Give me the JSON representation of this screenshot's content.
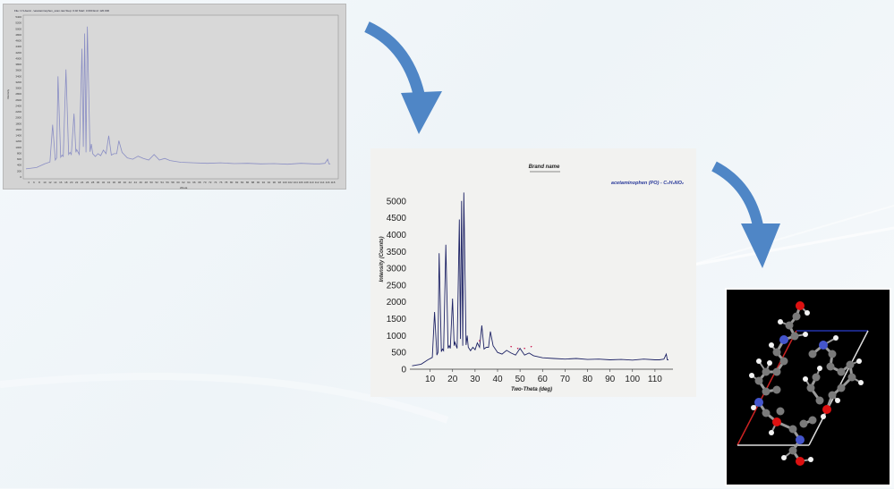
{
  "raw_plot": {
    "header_text": "File: C:\\Users\\...\\acetaminophen_scan.raw  Step: 0.02  Start: 3.000  End: 120.000",
    "ylabel": "Intensity",
    "xlabel": "2theta",
    "yticks": [
      "0",
      "200",
      "400",
      "600",
      "800",
      "1000",
      "1200",
      "1400",
      "1600",
      "1800",
      "2000",
      "2200",
      "2400",
      "2600",
      "2800",
      "3000",
      "3200",
      "3400",
      "3600",
      "3800",
      "4000",
      "4200",
      "4400",
      "4600",
      "4800",
      "5000",
      "5200",
      "5400"
    ],
    "xticks": [
      "4",
      "6",
      "8",
      "10",
      "12",
      "14",
      "16",
      "18",
      "20",
      "22",
      "24",
      "26",
      "28",
      "30",
      "32",
      "34",
      "36",
      "38",
      "40",
      "42",
      "44",
      "46",
      "48",
      "50",
      "52",
      "54",
      "56",
      "58",
      "60",
      "62",
      "64",
      "66",
      "68",
      "70",
      "72",
      "74",
      "76",
      "78",
      "80",
      "82",
      "84",
      "86",
      "88",
      "90",
      "92",
      "94",
      "96",
      "98",
      "100",
      "102",
      "104",
      "106",
      "108",
      "110",
      "112",
      "114",
      "116",
      "118"
    ],
    "line_color": "#8a8ec4"
  },
  "chart_data": {
    "type": "line",
    "title": "Brand name",
    "legend": "acetaminophen (PO) - C₈H₉NO₂",
    "xlabel": "Two-Theta (deg)",
    "ylabel": "Intensity (Counts)",
    "xlim": [
      1,
      118
    ],
    "ylim": [
      0,
      5500
    ],
    "xticks": [
      "10",
      "20",
      "30",
      "40",
      "50",
      "60",
      "70",
      "80",
      "90",
      "100",
      "110"
    ],
    "yticks": [
      "0",
      "500",
      "1000",
      "1500",
      "2000",
      "2500",
      "3000",
      "3500",
      "4000",
      "4500",
      "5000"
    ],
    "line_color": "#1f2466",
    "marker_color": "#cc2255",
    "series": [
      {
        "x": [
          2,
          6,
          9,
          11,
          12,
          13,
          13.5,
          14,
          15,
          15.5,
          16,
          17,
          18,
          18.5,
          19,
          20,
          20.7,
          21,
          22,
          23,
          23.5,
          24,
          24.5,
          25,
          26,
          26.5,
          27,
          28,
          29,
          30,
          31,
          32,
          33,
          34,
          35,
          36,
          36.8,
          38,
          40,
          42,
          44,
          46,
          48,
          50,
          52,
          54,
          56,
          60,
          65,
          70,
          75,
          80,
          85,
          90,
          95,
          100,
          105,
          110,
          112,
          114,
          115,
          115.5,
          116
        ],
        "y": [
          100,
          150,
          280,
          350,
          1700,
          420,
          500,
          3450,
          520,
          600,
          550,
          3700,
          620,
          700,
          620,
          2100,
          700,
          800,
          620,
          4450,
          900,
          5000,
          700,
          5250,
          720,
          1000,
          650,
          550,
          650,
          580,
          780,
          650,
          1300,
          600,
          650,
          650,
          1120,
          700,
          500,
          450,
          560,
          480,
          420,
          620,
          420,
          480,
          400,
          340,
          320,
          300,
          320,
          290,
          300,
          280,
          290,
          270,
          300,
          280,
          280,
          300,
          450,
          280,
          280
        ]
      }
    ],
    "peak_markers_x": [
      32,
      46,
      49,
      52,
      55
    ]
  },
  "molecule": {
    "background": "#000000",
    "cell_colors": [
      "#cc2222",
      "#2233aa",
      "#dddddd"
    ],
    "atom_colors": {
      "carbon": "#7a7a7a",
      "oxygen": "#dd1111",
      "nitrogen": "#4455cc",
      "hydrogen": "#f2f2f2"
    }
  },
  "arrows": {
    "color": "#4f86c6"
  }
}
